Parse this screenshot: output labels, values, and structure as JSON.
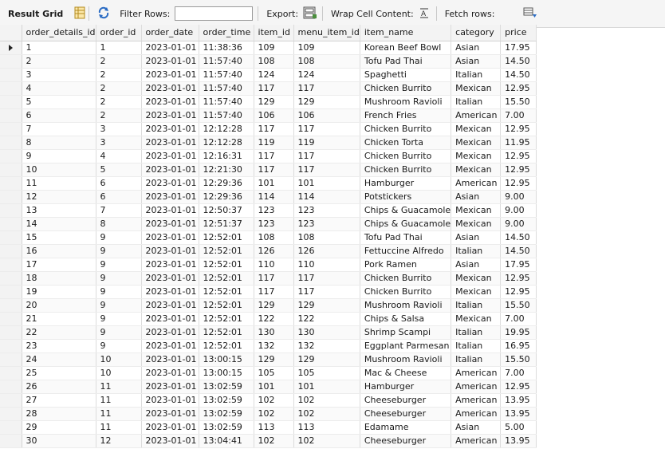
{
  "toolbar": {
    "result_grid_label": "Result Grid",
    "filter_rows_label": "Filter Rows:",
    "filter_rows_value": "",
    "export_label": "Export:",
    "wrap_cell_label": "Wrap Cell Content:",
    "fetch_rows_label": "Fetch rows:"
  },
  "grid": {
    "columns": [
      "order_details_id",
      "order_id",
      "order_date",
      "order_time",
      "item_id",
      "menu_item_id",
      "item_name",
      "category",
      "price"
    ],
    "rows": [
      [
        "1",
        "1",
        "2023-01-01",
        "11:38:36",
        "109",
        "109",
        "Korean Beef Bowl",
        "Asian",
        "17.95"
      ],
      [
        "2",
        "2",
        "2023-01-01",
        "11:57:40",
        "108",
        "108",
        "Tofu Pad Thai",
        "Asian",
        "14.50"
      ],
      [
        "3",
        "2",
        "2023-01-01",
        "11:57:40",
        "124",
        "124",
        "Spaghetti",
        "Italian",
        "14.50"
      ],
      [
        "4",
        "2",
        "2023-01-01",
        "11:57:40",
        "117",
        "117",
        "Chicken Burrito",
        "Mexican",
        "12.95"
      ],
      [
        "5",
        "2",
        "2023-01-01",
        "11:57:40",
        "129",
        "129",
        "Mushroom Ravioli",
        "Italian",
        "15.50"
      ],
      [
        "6",
        "2",
        "2023-01-01",
        "11:57:40",
        "106",
        "106",
        "French Fries",
        "American",
        "7.00"
      ],
      [
        "7",
        "3",
        "2023-01-01",
        "12:12:28",
        "117",
        "117",
        "Chicken Burrito",
        "Mexican",
        "12.95"
      ],
      [
        "8",
        "3",
        "2023-01-01",
        "12:12:28",
        "119",
        "119",
        "Chicken Torta",
        "Mexican",
        "11.95"
      ],
      [
        "9",
        "4",
        "2023-01-01",
        "12:16:31",
        "117",
        "117",
        "Chicken Burrito",
        "Mexican",
        "12.95"
      ],
      [
        "10",
        "5",
        "2023-01-01",
        "12:21:30",
        "117",
        "117",
        "Chicken Burrito",
        "Mexican",
        "12.95"
      ],
      [
        "11",
        "6",
        "2023-01-01",
        "12:29:36",
        "101",
        "101",
        "Hamburger",
        "American",
        "12.95"
      ],
      [
        "12",
        "6",
        "2023-01-01",
        "12:29:36",
        "114",
        "114",
        "Potstickers",
        "Asian",
        "9.00"
      ],
      [
        "13",
        "7",
        "2023-01-01",
        "12:50:37",
        "123",
        "123",
        "Chips & Guacamole",
        "Mexican",
        "9.00"
      ],
      [
        "14",
        "8",
        "2023-01-01",
        "12:51:37",
        "123",
        "123",
        "Chips & Guacamole",
        "Mexican",
        "9.00"
      ],
      [
        "15",
        "9",
        "2023-01-01",
        "12:52:01",
        "108",
        "108",
        "Tofu Pad Thai",
        "Asian",
        "14.50"
      ],
      [
        "16",
        "9",
        "2023-01-01",
        "12:52:01",
        "126",
        "126",
        "Fettuccine Alfredo",
        "Italian",
        "14.50"
      ],
      [
        "17",
        "9",
        "2023-01-01",
        "12:52:01",
        "110",
        "110",
        "Pork Ramen",
        "Asian",
        "17.95"
      ],
      [
        "18",
        "9",
        "2023-01-01",
        "12:52:01",
        "117",
        "117",
        "Chicken Burrito",
        "Mexican",
        "12.95"
      ],
      [
        "19",
        "9",
        "2023-01-01",
        "12:52:01",
        "117",
        "117",
        "Chicken Burrito",
        "Mexican",
        "12.95"
      ],
      [
        "20",
        "9",
        "2023-01-01",
        "12:52:01",
        "129",
        "129",
        "Mushroom Ravioli",
        "Italian",
        "15.50"
      ],
      [
        "21",
        "9",
        "2023-01-01",
        "12:52:01",
        "122",
        "122",
        "Chips & Salsa",
        "Mexican",
        "7.00"
      ],
      [
        "22",
        "9",
        "2023-01-01",
        "12:52:01",
        "130",
        "130",
        "Shrimp Scampi",
        "Italian",
        "19.95"
      ],
      [
        "23",
        "9",
        "2023-01-01",
        "12:52:01",
        "132",
        "132",
        "Eggplant Parmesan",
        "Italian",
        "16.95"
      ],
      [
        "24",
        "10",
        "2023-01-01",
        "13:00:15",
        "129",
        "129",
        "Mushroom Ravioli",
        "Italian",
        "15.50"
      ],
      [
        "25",
        "10",
        "2023-01-01",
        "13:00:15",
        "105",
        "105",
        "Mac & Cheese",
        "American",
        "7.00"
      ],
      [
        "26",
        "11",
        "2023-01-01",
        "13:02:59",
        "101",
        "101",
        "Hamburger",
        "American",
        "12.95"
      ],
      [
        "27",
        "11",
        "2023-01-01",
        "13:02:59",
        "102",
        "102",
        "Cheeseburger",
        "American",
        "13.95"
      ],
      [
        "28",
        "11",
        "2023-01-01",
        "13:02:59",
        "102",
        "102",
        "Cheeseburger",
        "American",
        "13.95"
      ],
      [
        "29",
        "11",
        "2023-01-01",
        "13:02:59",
        "113",
        "113",
        "Edamame",
        "Asian",
        "5.00"
      ],
      [
        "30",
        "12",
        "2023-01-01",
        "13:04:41",
        "102",
        "102",
        "Cheeseburger",
        "American",
        "13.95"
      ]
    ]
  }
}
